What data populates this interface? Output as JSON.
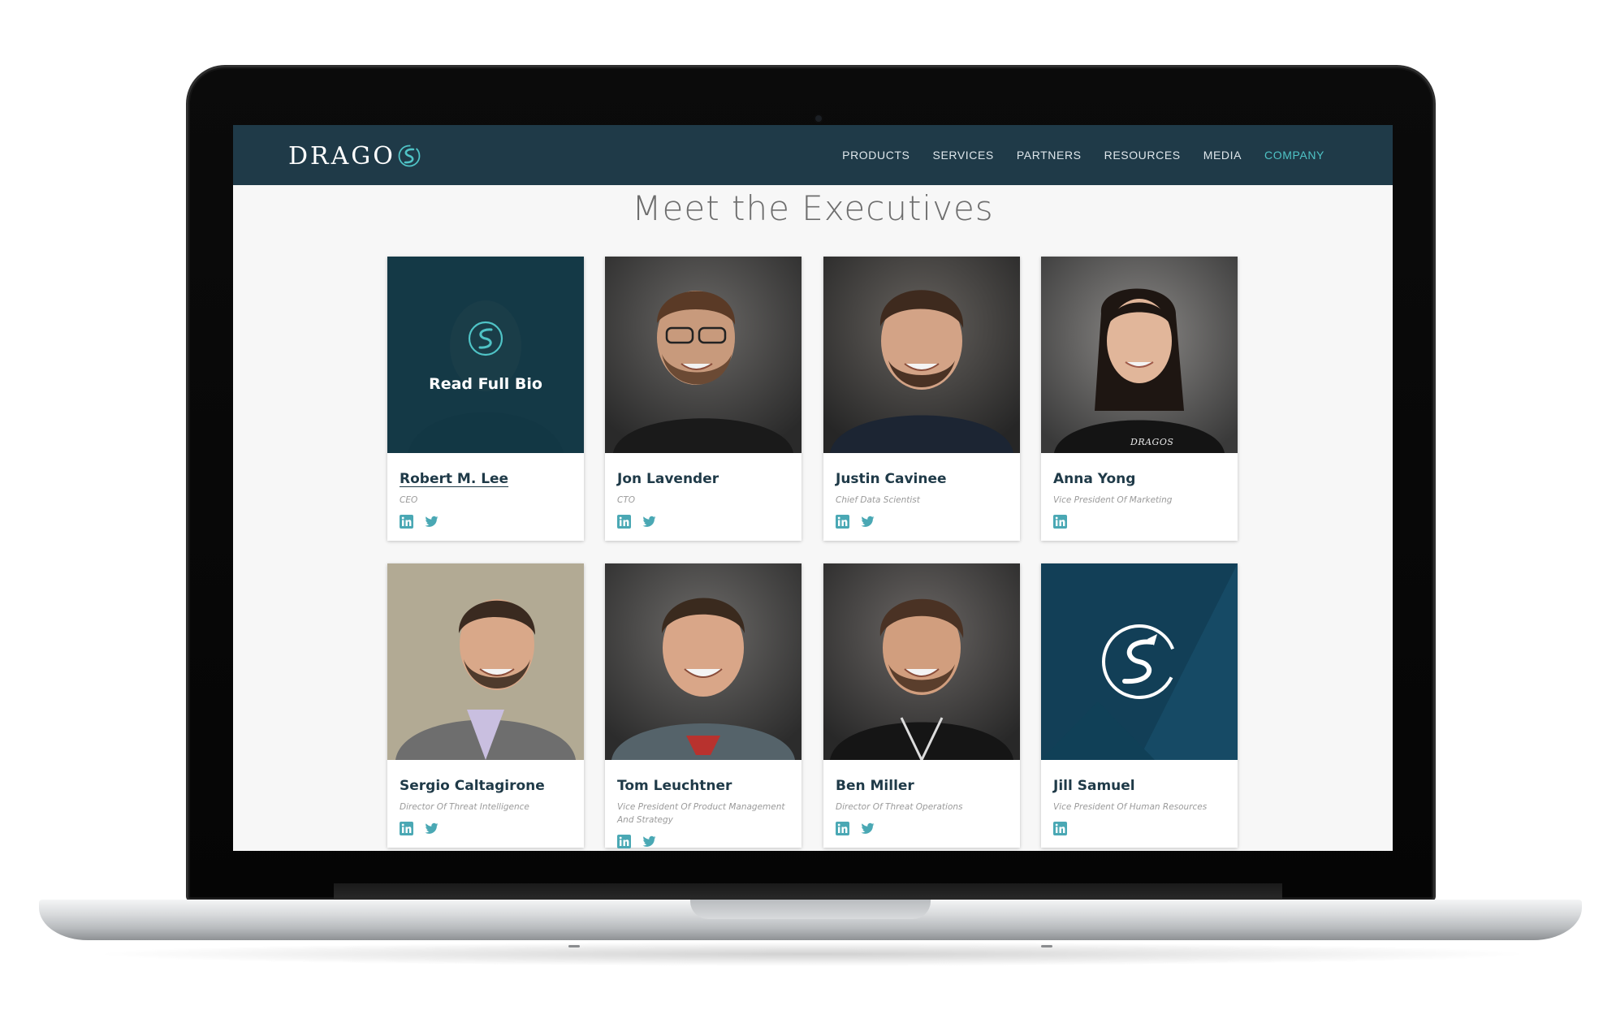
{
  "brand": {
    "logo_text": "DRAGO",
    "logo_glyph": "S"
  },
  "nav": {
    "items": [
      {
        "label": "PRODUCTS",
        "active": false
      },
      {
        "label": "SERVICES",
        "active": false
      },
      {
        "label": "PARTNERS",
        "active": false
      },
      {
        "label": "RESOURCES",
        "active": false
      },
      {
        "label": "MEDIA",
        "active": false
      },
      {
        "label": "COMPANY",
        "active": true
      }
    ]
  },
  "page": {
    "title": "Meet the Executives"
  },
  "executives": [
    {
      "name": "Robert M. Lee",
      "title": "CEO",
      "linkedin": true,
      "twitter": true,
      "overlay": "Read Full Bio"
    },
    {
      "name": "Jon Lavender",
      "title": "CTO",
      "linkedin": true,
      "twitter": true
    },
    {
      "name": "Justin Cavinee",
      "title": "Chief Data Scientist",
      "linkedin": true,
      "twitter": true
    },
    {
      "name": "Anna Yong",
      "title": "Vice President Of Marketing",
      "linkedin": true,
      "twitter": false,
      "shirt_logo": "DRAGOS"
    },
    {
      "name": "Sergio Caltagirone",
      "title": "Director Of Threat Intelligence",
      "linkedin": true,
      "twitter": true
    },
    {
      "name": "Tom Leuchtner",
      "title": "Vice President Of Product Management And Strategy",
      "linkedin": true,
      "twitter": true
    },
    {
      "name": "Ben Miller",
      "title": "Director Of Threat Operations",
      "linkedin": true,
      "twitter": true
    },
    {
      "name": "Jill Samuel",
      "title": "Vice President Of Human Resources",
      "linkedin": true,
      "twitter": false
    }
  ],
  "colors": {
    "navbar": "#1f3a48",
    "accent": "#4fc3c6",
    "name_text": "#1f3a48",
    "title_text": "#9a9a9a",
    "placeholder_bg": "#123f57"
  },
  "icons": {
    "linkedin": "linkedin-icon",
    "twitter": "twitter-icon"
  }
}
